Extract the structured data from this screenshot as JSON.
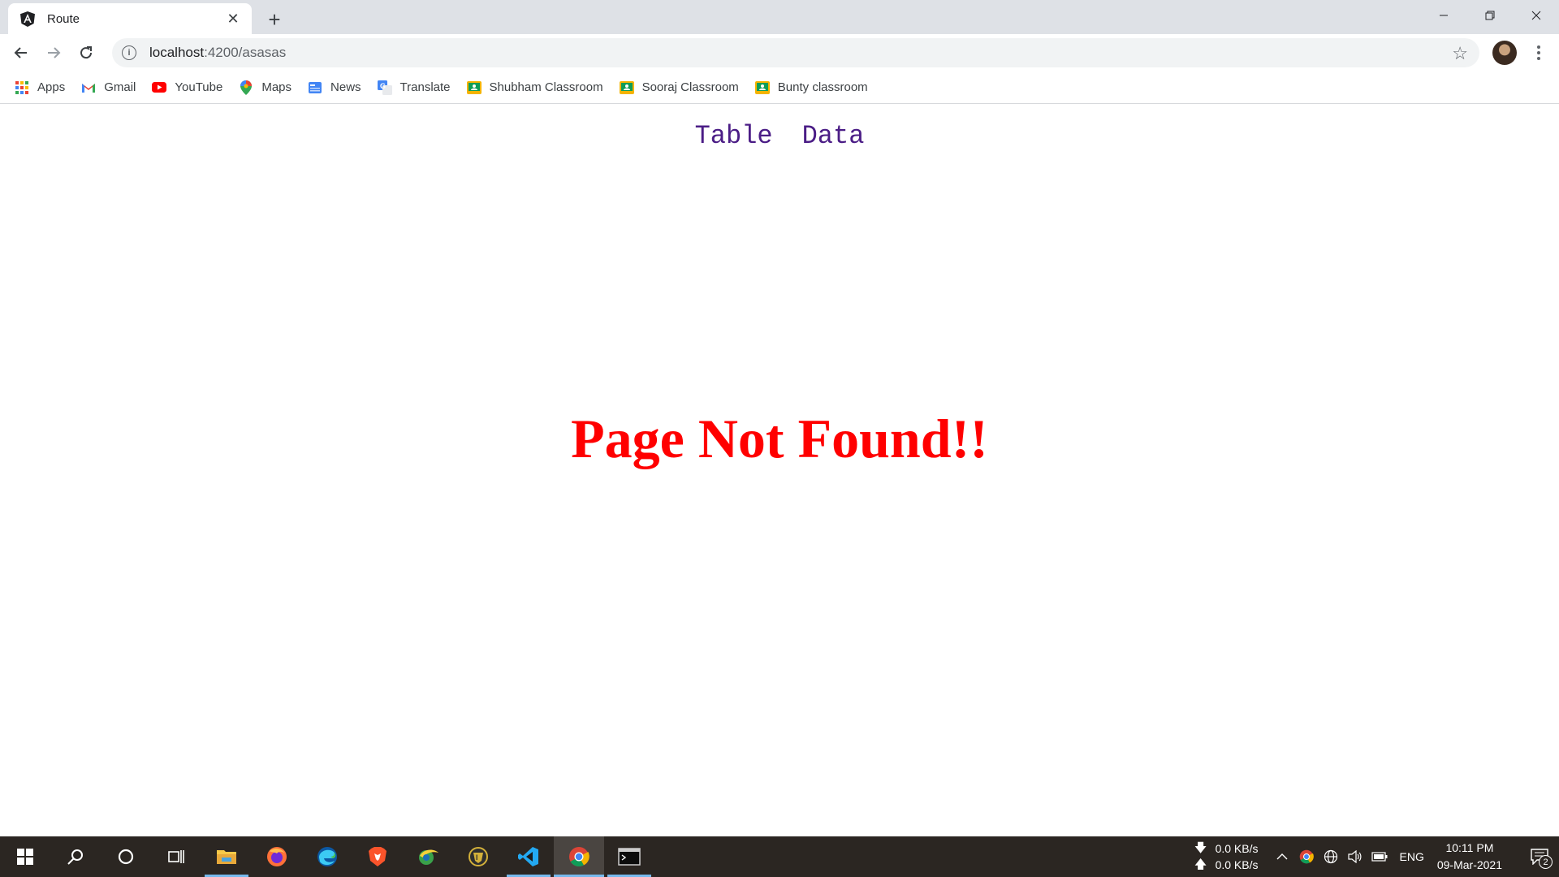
{
  "browser": {
    "tab": {
      "title": "Route",
      "favicon": "angular-icon"
    },
    "address": {
      "host": "localhost",
      "path": ":4200/asasas"
    },
    "bookmarks": [
      {
        "label": "Apps",
        "icon": "apps-grid-icon"
      },
      {
        "label": "Gmail",
        "icon": "gmail-icon"
      },
      {
        "label": "YouTube",
        "icon": "youtube-icon"
      },
      {
        "label": "Maps",
        "icon": "maps-icon"
      },
      {
        "label": "News",
        "icon": "news-icon"
      },
      {
        "label": "Translate",
        "icon": "translate-icon"
      },
      {
        "label": "Shubham Classroom",
        "icon": "classroom-icon"
      },
      {
        "label": "Sooraj Classroom",
        "icon": "classroom-icon"
      },
      {
        "label": "Bunty classroom",
        "icon": "classroom-icon"
      }
    ]
  },
  "page": {
    "nav": {
      "table_link": "Table",
      "data_link": "Data"
    },
    "message": "Page Not Found!!",
    "colors": {
      "message": "#ff0000",
      "nav_link": "#4b1d86"
    }
  },
  "taskbar": {
    "net": {
      "down": "0.0 KB/s",
      "up": "0.0 KB/s"
    },
    "lang": "ENG",
    "time": "10:11 PM",
    "date": "09-Mar-2021",
    "notifications": "2"
  }
}
